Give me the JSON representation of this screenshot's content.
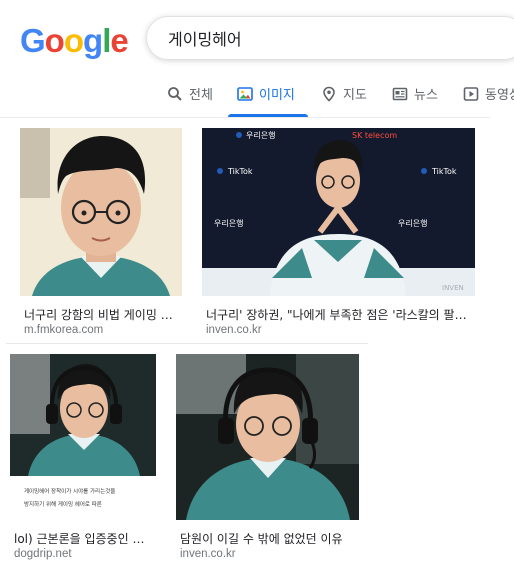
{
  "logo": {
    "text": "Google",
    "letters": [
      {
        "ch": "G",
        "color": "#4285F4"
      },
      {
        "ch": "o",
        "color": "#EA4335"
      },
      {
        "ch": "o",
        "color": "#FBBC05"
      },
      {
        "ch": "g",
        "color": "#4285F4"
      },
      {
        "ch": "l",
        "color": "#34A853"
      },
      {
        "ch": "e",
        "color": "#EA4335"
      }
    ]
  },
  "search": {
    "value": "게이밍헤어"
  },
  "tabs": [
    {
      "label": "전체",
      "icon": "search-icon"
    },
    {
      "label": "이미지",
      "icon": "image-icon",
      "active": true
    },
    {
      "label": "지도",
      "icon": "map-pin-icon"
    },
    {
      "label": "뉴스",
      "icon": "news-icon"
    },
    {
      "label": "동영상",
      "icon": "video-icon"
    }
  ],
  "results": [
    {
      "caption": "너구리 강함의 비법 게이밍 헤어",
      "source": "m.fmkorea.com"
    },
    {
      "caption": "너구리' 장하권, \"나에게 부족한 점은 '라스칼의 팔자 눈썹'\"",
      "source": "inven.co.kr"
    },
    {
      "caption": "lol) 근본론을 입증중인 너구리 게이밍 헤어",
      "source": "dogdrip.net",
      "overlay_text": [
        "게이밍헤어 장착이가 시야를 가리는것을",
        "방지하기 위해 게이밍 헤어로 따른"
      ]
    },
    {
      "caption": "담원이 이길 수 밖에 없었던 이유",
      "source": "inven.co.kr"
    }
  ],
  "sponsor_text": [
    "우리은행",
    "SK telecom",
    "TikTok",
    "INVEN"
  ],
  "colors": {
    "accent": "#1a73e8",
    "jersey": "#3a8a8c"
  }
}
